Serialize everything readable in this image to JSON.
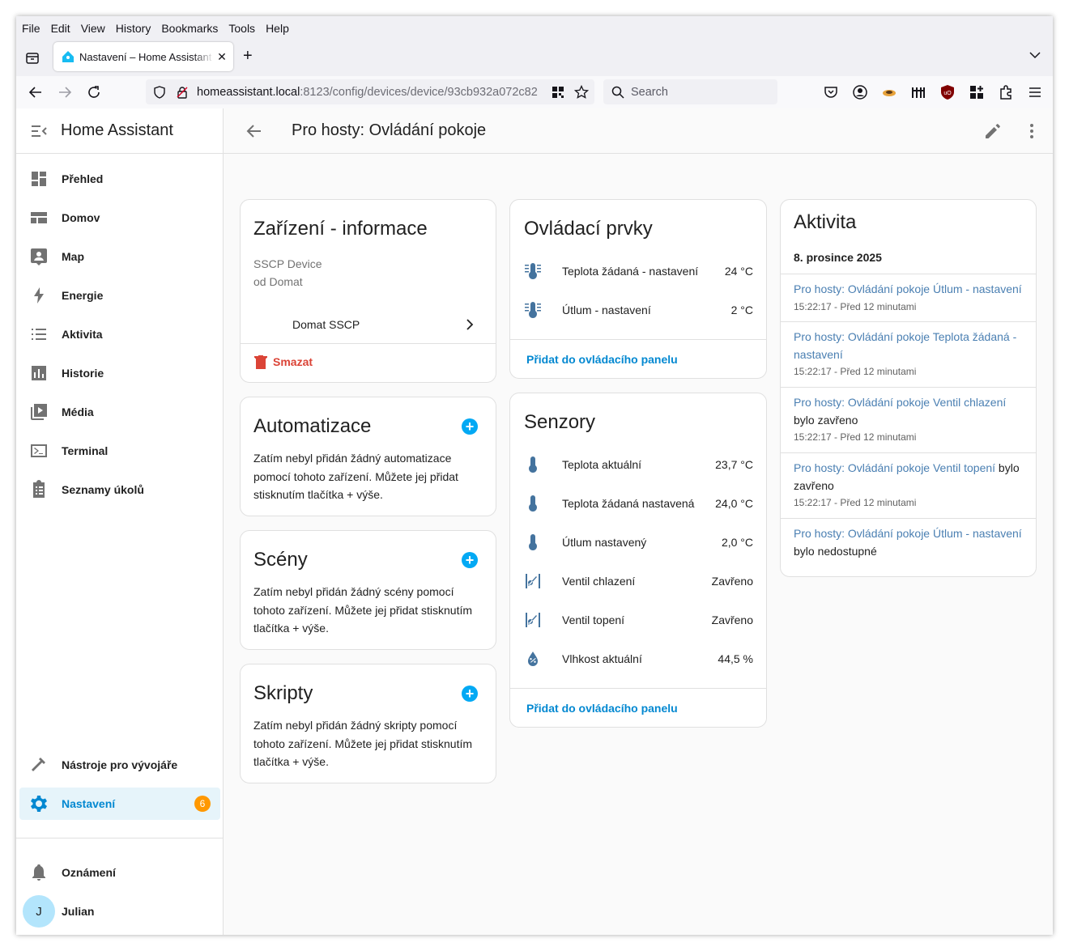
{
  "browser": {
    "menu": [
      "File",
      "Edit",
      "View",
      "History",
      "Bookmarks",
      "Tools",
      "Help"
    ],
    "tab_title": "Nastavení – Home Assistant",
    "tab_close": "✕",
    "new_tab": "+",
    "url_host": "homeassistant.local",
    "url_path": ":8123/config/devices/device/93cb932a072c82",
    "search_placeholder": "Search"
  },
  "sidebar": {
    "app_title": "Home Assistant",
    "items": [
      {
        "label": "Přehled",
        "icon": "dashboard-icon"
      },
      {
        "label": "Domov",
        "icon": "home-view-icon"
      },
      {
        "label": "Map",
        "icon": "map-icon"
      },
      {
        "label": "Energie",
        "icon": "lightning-icon"
      },
      {
        "label": "Aktivita",
        "icon": "list-icon"
      },
      {
        "label": "Historie",
        "icon": "chart-icon"
      },
      {
        "label": "Média",
        "icon": "media-icon"
      },
      {
        "label": "Terminal",
        "icon": "terminal-icon"
      },
      {
        "label": "Seznamy úkolů",
        "icon": "clipboard-icon"
      }
    ],
    "dev_tools": "Nástroje pro vývojáře",
    "settings": "Nastavení",
    "settings_badge": "6",
    "notifications": "Oznámení",
    "user_name": "Julian",
    "user_initial": "J"
  },
  "header": {
    "title": "Pro hosty: Ovládání pokoje"
  },
  "device_info": {
    "title": "Zařízení - informace",
    "model": "SSCP Device",
    "manufacturer": "od Domat",
    "integration": "Domat SSCP",
    "delete": "Smazat"
  },
  "automations": {
    "title": "Automatizace",
    "text": "Zatím nebyl přidán žádný automatizace pomocí tohoto zařízení. Můžete jej přidat stisknutím tlačítka + výše."
  },
  "scenes": {
    "title": "Scény",
    "text": "Zatím nebyl přidán žádný scény pomocí tohoto zařízení. Můžete jej přidat stisknutím tlačítka + výše."
  },
  "scripts": {
    "title": "Skripty",
    "text": "Zatím nebyl přidán žádný skripty pomocí tohoto zařízení. Můžete jej přidat stisknutím tlačítka + výše."
  },
  "controls": {
    "title": "Ovládací prvky",
    "rows": [
      {
        "label": "Teplota žádaná - nastavení",
        "value": "24 °C"
      },
      {
        "label": "Útlum - nastavení",
        "value": "2 °C"
      }
    ],
    "add": "Přidat do ovládacího panelu"
  },
  "sensors": {
    "title": "Senzory",
    "rows": [
      {
        "label": "Teplota aktuální",
        "value": "23,7 °C"
      },
      {
        "label": "Teplota žádaná nastavená",
        "value": "24,0 °C"
      },
      {
        "label": "Útlum nastavený",
        "value": "2,0 °C"
      },
      {
        "label": "Ventil chlazení",
        "value": "Zavřeno"
      },
      {
        "label": "Ventil topení",
        "value": "Zavřeno"
      },
      {
        "label": "Vlhkost aktuální",
        "value": "44,5 %"
      }
    ],
    "add": "Přidat do ovládacího panelu"
  },
  "activity": {
    "title": "Aktivita",
    "date": "8. prosince 2025",
    "entries": [
      {
        "link": "Pro hosty: Ovládání pokoje Útlum - nastavení",
        "suffix": "",
        "time": "15:22:17 - Před 12 minutami"
      },
      {
        "link": "Pro hosty: Ovládání pokoje Teplota žádaná - nastavení",
        "suffix": "",
        "time": "15:22:17 - Před 12 minutami"
      },
      {
        "link": "Pro hosty: Ovládání pokoje Ventil chlazení",
        "suffix": " bylo zavřeno",
        "time": "15:22:17 - Před 12 minutami"
      },
      {
        "link": "Pro hosty: Ovládání pokoje Ventil topení",
        "suffix": " bylo zavřeno",
        "time": "15:22:17 - Před 12 minutami"
      },
      {
        "link": "Pro hosty: Ovládání pokoje Útlum - nastavení",
        "suffix": " bylo nedostupné",
        "time": ""
      }
    ]
  }
}
